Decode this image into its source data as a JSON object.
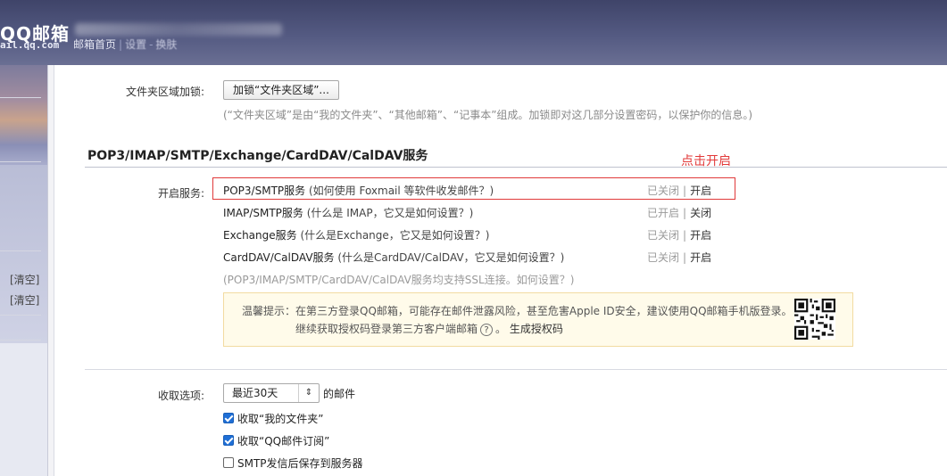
{
  "header": {
    "logo": "QQ邮箱",
    "logo_domain": "ail.qq.com",
    "nav": [
      "邮箱首页",
      "设置",
      "换肤"
    ]
  },
  "sidebar": {
    "clear_1": "[清空]",
    "clear_2": "[清空]"
  },
  "folder_lock": {
    "label": "文件夹区域加锁:",
    "button": "加锁“文件夹区域”...",
    "hint": "(“文件夹区域”是由“我的文件夹”、“其他邮箱”、“记事本”组成。加锁即对这几部分设置密码，以保护你的信息。)"
  },
  "section": {
    "title": "POP3/IMAP/SMTP/Exchange/CardDAV/CalDAV服务",
    "annotation": "点击开启"
  },
  "services": {
    "label": "开启服务:",
    "items": [
      {
        "name": "POP3/SMTP服务",
        "help": "(如何使用 Foxmail 等软件收发邮件？)",
        "status": "已关闭",
        "action": "开启"
      },
      {
        "name": "IMAP/SMTP服务",
        "help": "(什么是 IMAP，它又是如何设置？)",
        "status": "已开启",
        "action": "关闭"
      },
      {
        "name": "Exchange服务",
        "help": "(什么是Exchange，它又是如何设置？)",
        "status": "已关闭",
        "action": "开启"
      },
      {
        "name": "CardDAV/CalDAV服务",
        "help": "(什么是CardDAV/CalDAV，它又是如何设置？)",
        "status": "已关闭",
        "action": "开启"
      }
    ],
    "ssl_note": "(POP3/IMAP/SMTP/CardDAV/CalDAV服务均支持SSL连接。如何设置？)",
    "separator": "|"
  },
  "tip": {
    "line1": "温馨提示：在第三方登录QQ邮箱，可能存在邮件泄露风险，甚至危害Apple ID安全，建议使用QQ邮箱手机版登录。",
    "line2_prefix": "继续获取授权码登录第三方客户端邮箱",
    "help_icon": "?",
    "line2_suffix": "。",
    "link": "生成授权码"
  },
  "receive": {
    "label": "收取选项:",
    "select_value": "最近30天",
    "select_suffix": "的邮件",
    "options": [
      {
        "label": "收取“我的文件夹”",
        "checked": true
      },
      {
        "label": "收取“QQ邮件订阅”",
        "checked": true
      },
      {
        "label": "SMTP发信后保存到服务器",
        "checked": false
      }
    ]
  },
  "colors": {
    "accent_red": "#e23a3a",
    "checkbox_blue": "#1f6fd6",
    "header_bg": "#4b5077"
  }
}
